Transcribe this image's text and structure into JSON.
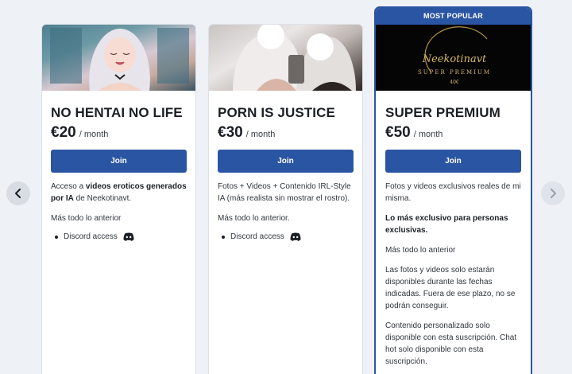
{
  "badge": {
    "most_popular": "MOST POPULAR"
  },
  "period_label": "/ month",
  "join_label": "Join",
  "tiers": [
    {
      "name": "NO HENTAI NO LIFE",
      "price": "€20",
      "desc_before": "Acceso a ",
      "desc_bold": "videos eroticos generados por IA",
      "desc_after": " de Neekotinavt.",
      "extra": "Más todo lo anterior",
      "perk": "Discord access"
    },
    {
      "name": "PORN IS JUSTICE",
      "price": "€30",
      "desc": "Fotos + Videos + Contenido IRL-Style IA (más realista sin mostrar el rostro).",
      "extra": "Más todo lo anterior.",
      "perk": "Discord access"
    },
    {
      "name": "SUPER PREMIUM",
      "price": "€50",
      "image_text": {
        "logo": "Neekotinavt",
        "subtitle": "SUPER PREMIUM",
        "price": "40€"
      },
      "desc": "Fotos y videos exclusivos reales de mi misma.",
      "highlight": "Lo más exclusivo para personas exclusivas.",
      "extra": "Más todo lo anterior",
      "notice": "Las fotos y videos solo estarán disponibles durante las fechas indicadas. Fuera de ese plazo, no se podrán conseguir.",
      "custom": "Contenido personalizado solo disponible con esta suscripción. Chat hot solo disponible con esta suscripción."
    }
  ],
  "colors": {
    "accent": "#2a55a3",
    "background": "#eef1f6",
    "gold": "#c9a44a"
  },
  "icons": {
    "prev": "chevron-left-icon",
    "next": "chevron-right-icon",
    "bullet": "bullet-icon",
    "discord": "discord-icon"
  }
}
